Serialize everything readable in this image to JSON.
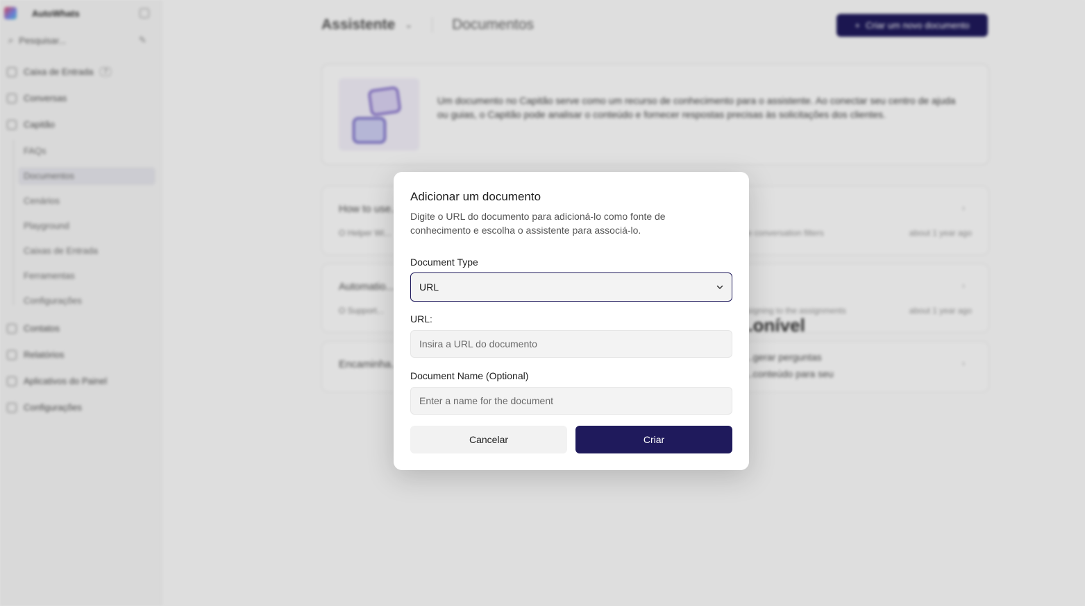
{
  "app": {
    "brand": "AutoWhats",
    "search_placeholder": "Pesquisar...",
    "nav": [
      {
        "label": "Caixa de Entrada",
        "badge": "7"
      },
      {
        "label": "Conversas"
      },
      {
        "label": "Capitão"
      },
      {
        "label": "Contatos"
      },
      {
        "label": "Relatórios"
      },
      {
        "label": "Aplicativos do Painel"
      },
      {
        "label": "Configurações"
      }
    ],
    "captain_sub": [
      "FAQs",
      "Documentos",
      "Cenários",
      "Playground",
      "Caixas de Entrada",
      "Ferramentas",
      "Configurações"
    ],
    "breadcrumb": {
      "assistant": "Assistente",
      "section": "Documentos"
    },
    "create_doc_label": "Criar um novo documento",
    "info_text": "Um documento no Capitão serve como um recurso de conhecimento para o assistente. Ao conectar seu centro de ajuda ou guias, o Capitão pode analisar o conteúdo e fornecer respostas precisas às solicitações dos clientes.",
    "rows": [
      {
        "title": "How to use...",
        "sub": "O Helper Wi...",
        "tag": "...use conversation filters",
        "meta": "about 1 year ago"
      },
      {
        "title": "Automatio...",
        "sub": "O Support...",
        "tag": "...assigning to the assignments",
        "meta": "about 1 year ago"
      },
      {
        "title": "Encaminha...",
        "sub": "",
        "tag": "",
        "meta": ""
      }
    ],
    "empty_title": "...onível",
    "empty_sub": "...gerar perguntas ...conteúdo para seu"
  },
  "modal": {
    "title": "Adicionar um documento",
    "description": "Digite o URL do documento para adicioná-lo como fonte de conhecimento e escolha o assistente para associá-lo.",
    "document_type_label": "Document Type",
    "document_type_value": "URL",
    "url_label": "URL:",
    "url_placeholder": "Insira a URL do documento",
    "name_label": "Document Name (Optional)",
    "name_placeholder": "Enter a name for the document",
    "cancel_label": "Cancelar",
    "create_label": "Criar"
  },
  "colors": {
    "primary": "#1f1a5c",
    "input_bg": "#f3f3f3"
  }
}
